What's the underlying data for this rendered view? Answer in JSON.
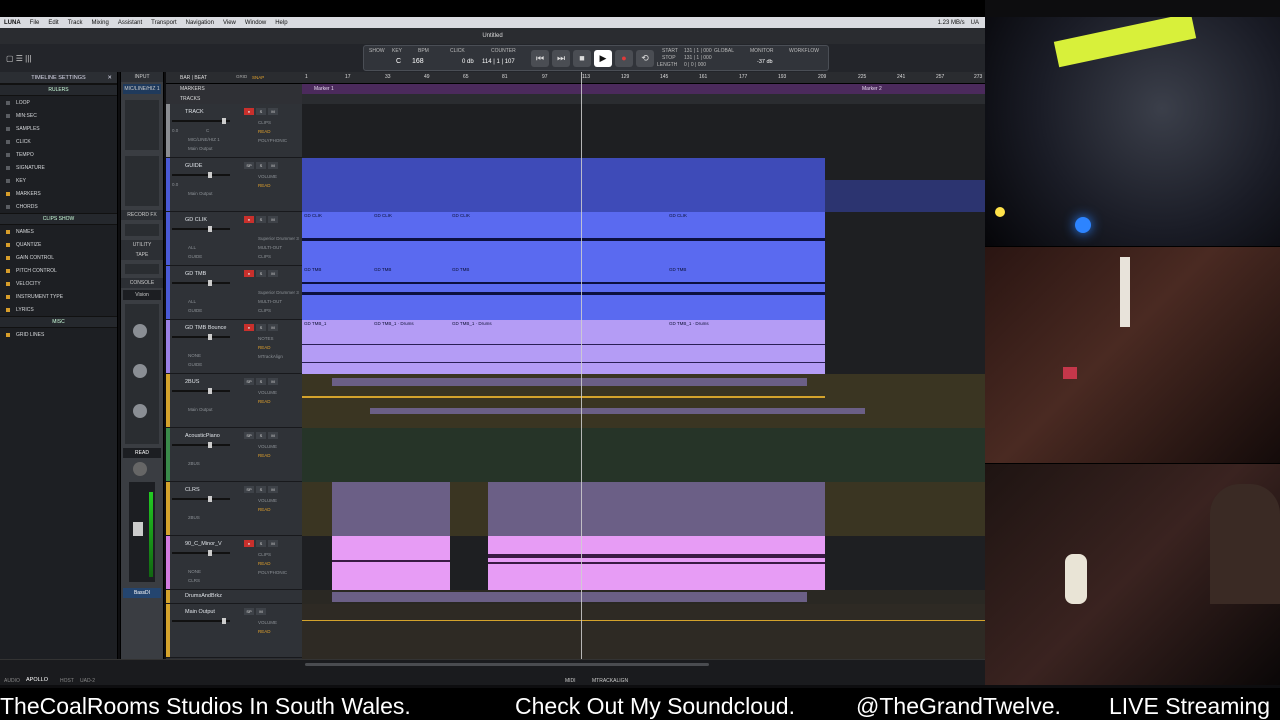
{
  "app": {
    "name": "LUNA",
    "menus": [
      "File",
      "Edit",
      "Track",
      "Mixing",
      "Assistant",
      "Transport",
      "Navigation",
      "View",
      "Window",
      "Help"
    ],
    "window_title": "Untitled",
    "status_right": [
      "1.23 MB/s",
      "8.7 KB/s",
      "UA"
    ]
  },
  "toolbar": {
    "show": "SHOW",
    "key_label": "KEY",
    "key": "C",
    "bpm_label": "BPM",
    "bpm": "168",
    "click_label": "CLICK",
    "click_value": "0 db",
    "counter_label": "COUNTER",
    "counter": "114 | 1 | 107",
    "start_label": "START",
    "stop_label": "STOP",
    "length_label": "LENGTH",
    "start": "131 | 1 | 000",
    "stop": "131 | 1 | 000",
    "length": "0 | 0 | 000",
    "global_label": "GLOBAL",
    "monitor_label": "MONITOR",
    "monitor_value": "-37 db",
    "workflow_label": "WORKFLOW"
  },
  "timeline_settings": {
    "title": "TIMELINE SETTINGS",
    "rulers_header": "RULERS",
    "rulers": [
      {
        "label": "LOOP",
        "on": false
      },
      {
        "label": "MIN:SEC",
        "on": false
      },
      {
        "label": "SAMPLES",
        "on": false
      },
      {
        "label": "CLICK",
        "on": false
      },
      {
        "label": "TEMPO",
        "on": false
      },
      {
        "label": "SIGNATURE",
        "on": false
      },
      {
        "label": "KEY",
        "on": false
      },
      {
        "label": "MARKERS",
        "on": true
      },
      {
        "label": "CHORDS",
        "on": false
      }
    ],
    "clips_header": "CLIPS SHOW",
    "clips": [
      {
        "label": "NAMES",
        "on": true
      },
      {
        "label": "QUANTIZE",
        "on": true
      },
      {
        "label": "GAIN CONTROL",
        "on": true
      },
      {
        "label": "PITCH CONTROL",
        "on": true
      },
      {
        "label": "VELOCITY",
        "on": true
      },
      {
        "label": "INSTRUMENT TYPE",
        "on": true
      },
      {
        "label": "LYRICS",
        "on": true
      }
    ],
    "misc_header": "MISC",
    "misc": [
      {
        "label": "GRID LINES",
        "on": true
      }
    ]
  },
  "input_strip": {
    "input_label": "INPUT",
    "input_value": "MIC/LINE/HIZ 1",
    "record_fx": "RECORD FX",
    "utility": "UTILITY",
    "tape": "TAPE",
    "console": "CONSOLE",
    "console_value": "Vision",
    "read": "READ",
    "bottom_name": "BassDI"
  },
  "grid_header": {
    "bar_beat": "BAR | BEAT",
    "grid": "GRID",
    "snap": "SNAP",
    "markers": "MARKERS",
    "tracks": "TRACKS"
  },
  "ruler_ticks": [
    "1",
    "17",
    "33",
    "49",
    "65",
    "81",
    "97",
    "113",
    "129",
    "145",
    "161",
    "177",
    "193",
    "209",
    "225",
    "241",
    "257",
    "273"
  ],
  "markers": [
    "Marker 1",
    "Marker 2"
  ],
  "tracks": [
    {
      "name": "TRACK",
      "view": "CLIPS",
      "auto": "READ",
      "in": "MIC/LINE/HIZ 1",
      "warp": "POLYPHONIC",
      "out": "Main Output",
      "vol": "0.0",
      "pan": "C"
    },
    {
      "name": "GUIDE",
      "view": "VOLUME",
      "auto": "READ",
      "out": "Main Output",
      "vol": "0.0",
      "pan": "100L",
      "pan2": "100R"
    },
    {
      "name": "GD CLIK",
      "inst": "Superior Drummer 3",
      "solo": "MULTI-OUT",
      "view": "CLIPS",
      "auto": "OFF",
      "out": "GUIDE",
      "midi": "ALL"
    },
    {
      "name": "GD TMB",
      "inst": "Superior Drummer 3",
      "solo": "MULTI-OUT",
      "view": "CLIPS",
      "auto": "OFF",
      "out": "GUIDE",
      "midi": "ALL"
    },
    {
      "name": "GD TMB Bounce",
      "view": "NOTES",
      "auto": "READ",
      "in": "NONE",
      "warp": "MTrackAlign",
      "out": "GUIDE"
    },
    {
      "name": "2BUS",
      "view": "VOLUME",
      "auto": "READ",
      "out": "Main Output"
    },
    {
      "name": "AcousticPiano",
      "view": "VOLUME",
      "auto": "READ",
      "out": "2BUS"
    },
    {
      "name": "CLRS",
      "view": "VOLUME",
      "auto": "READ",
      "out": "2BUS"
    },
    {
      "name": "90_C_Minor_V",
      "view": "CLIPS",
      "auto": "READ",
      "in": "NONE",
      "warp": "POLYPHONIC",
      "out": "CLRS"
    },
    {
      "name": "DrumsAndBrkz"
    },
    {
      "name": "Main Output",
      "view": "VOLUME",
      "auto": "READ"
    }
  ],
  "clip_labels": {
    "clik": [
      "GD CLIK",
      "GD CLIK",
      "GD CLIK",
      "GD CLIK"
    ],
    "tmb": [
      "GD TMB",
      "GD TMB",
      "GD TMB",
      "GD TMB"
    ],
    "bounce": [
      "GD TMB_1",
      "GD TMB_1 · Drums",
      "GD TMB_1 · Drums",
      "GD TMB_1 · Drums"
    ]
  },
  "bottom": {
    "audio": "AUDIO",
    "apollo": "APOLLO",
    "host": "HOST",
    "uad": "UAD-2",
    "midi": "MIDI",
    "mtrack": "MTRACKALIGN"
  },
  "ticker": [
    "TheCoalRooms Studios In South Wales.",
    "Check Out My Soundcloud.",
    "@TheGrandTwelve.",
    "LIVE Streaming"
  ],
  "colors": {
    "blue_clip": "#5a6af0",
    "purple_clip": "#a98cf0",
    "pink_clip": "#e79cf5",
    "marker_bar": "#5b2c74"
  }
}
